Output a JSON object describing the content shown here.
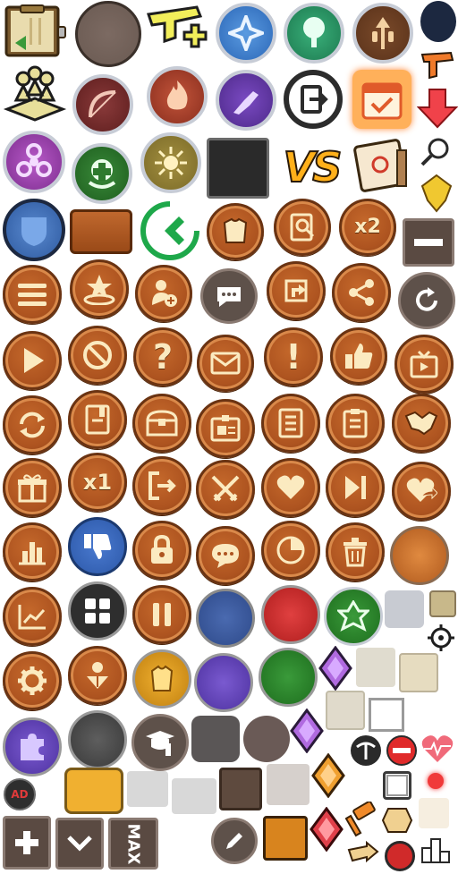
{
  "sheet": {
    "labels": {
      "vs": "VS",
      "x2": "x2",
      "x1": "x1",
      "max": "MAX",
      "ad": "AD"
    },
    "colors": {
      "brown": "#ae5420",
      "brown_border": "#6a3312",
      "cream": "#fbeac0",
      "blue": "#3a5c9e",
      "red": "#d02a2a",
      "green": "#2e8a2e",
      "purple": "#6b42b0",
      "gold": "#e0a020",
      "dark": "#2a2a2a",
      "grey": "#c8c8c8"
    },
    "icons": [
      "clipboard-icon",
      "stone-circle-icon",
      "gun-plus-icon",
      "blue-star-emblem-icon",
      "tree-emblem-icon",
      "arrow-emblem-icon",
      "navy-circle-icon",
      "team-pedestal-icon",
      "bow-emblem-icon",
      "fire-emblem-icon",
      "purple-arm-emblem-icon",
      "exit-door-icon",
      "calendar-check-icon",
      "orange-pistol-icon",
      "red-down-arrow-icon",
      "biohazard-icon",
      "heal-emblem-icon",
      "sun-emblem-icon",
      "black-square-icon",
      "vs-logo",
      "calendar-book-icon",
      "search-icon",
      "gold-emblem-icon",
      "blue-shield-icon",
      "brown-plank-icon",
      "green-back-arrow-icon",
      "armor-icon",
      "id-search-icon",
      "x2-button",
      "minus-button",
      "menu-icon",
      "spawn-icon",
      "add-user-icon",
      "chat-icon",
      "map-arrow-icon",
      "share-icon",
      "refresh-icon",
      "play-icon",
      "forbid-icon",
      "help-icon",
      "mail-icon",
      "alert-icon",
      "like-icon",
      "tv-icon",
      "swap-icon",
      "book-icon",
      "chest-icon",
      "id-card-icon",
      "list-icon",
      "clipboard-list-icon",
      "handshake-icon",
      "gift-icon",
      "x1-button",
      "exit-icon",
      "crossed-swords-icon",
      "heart-icon",
      "skip-icon",
      "heart-share-icon",
      "bar-chart-icon",
      "dislike-icon",
      "lock-icon",
      "chat-bubble-icon",
      "pie-chart-icon",
      "trash-icon",
      "orange-blank-icon",
      "line-chart-icon",
      "grid-icon",
      "pause-icon",
      "blue-blank-icon",
      "red-blank-icon",
      "green-emblem-icon",
      "grey-square-icon",
      "tan-square-icon",
      "crosshair-icon",
      "gear-icon",
      "location-user-icon",
      "gold-jacket-icon",
      "purple-blank-icon",
      "green-blank-icon",
      "purple-gem-icon",
      "cream-square-icon",
      "cream-square-2-icon",
      "puzzle-icon",
      "dark-blank-icon",
      "tutorial-icon",
      "dark-square-icon",
      "dark-round-icon",
      "purple-gem-2-icon",
      "beige-square-icon",
      "frame-icon",
      "no-ads-icon",
      "gold-tag-icon",
      "tooltip-icon",
      "tooltip-2-icon",
      "brown-square-icon",
      "light-square-icon",
      "orange-gem-icon",
      "pickaxe-icon",
      "no-entry-icon",
      "heartbeat-icon",
      "plus-button",
      "chevron-down-button",
      "max-button",
      "pencil-icon",
      "orange-square-icon",
      "red-gem-icon",
      "hammer-icon",
      "shield-badge-icon",
      "red-dot-icon",
      "cream-blank-icon",
      "pointer-icon",
      "record-icon",
      "podium-icon"
    ]
  }
}
